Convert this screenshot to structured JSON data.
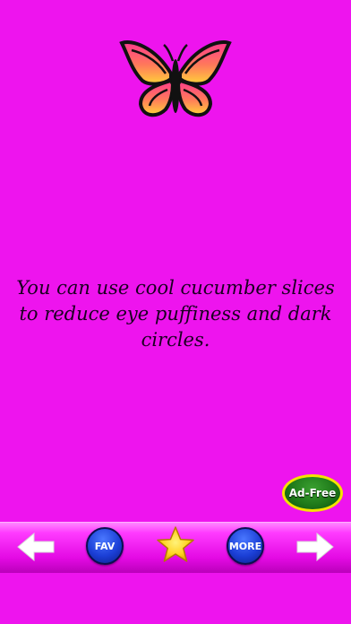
{
  "tip": {
    "text": "You can use cool cucumber slices to reduce eye puffiness and dark circles."
  },
  "ad_free": {
    "label": "Ad-Free"
  },
  "toolbar": {
    "fav_label": "FAV",
    "more_label": "MORE",
    "prev_icon": "arrow-left-icon",
    "next_icon": "arrow-right-icon",
    "star_icon": "star-icon"
  },
  "colors": {
    "background": "#ee14ee",
    "button_blue": "#1b3fd6",
    "star_gold": "#ffd21f",
    "ad_green": "#1f7a1a"
  }
}
